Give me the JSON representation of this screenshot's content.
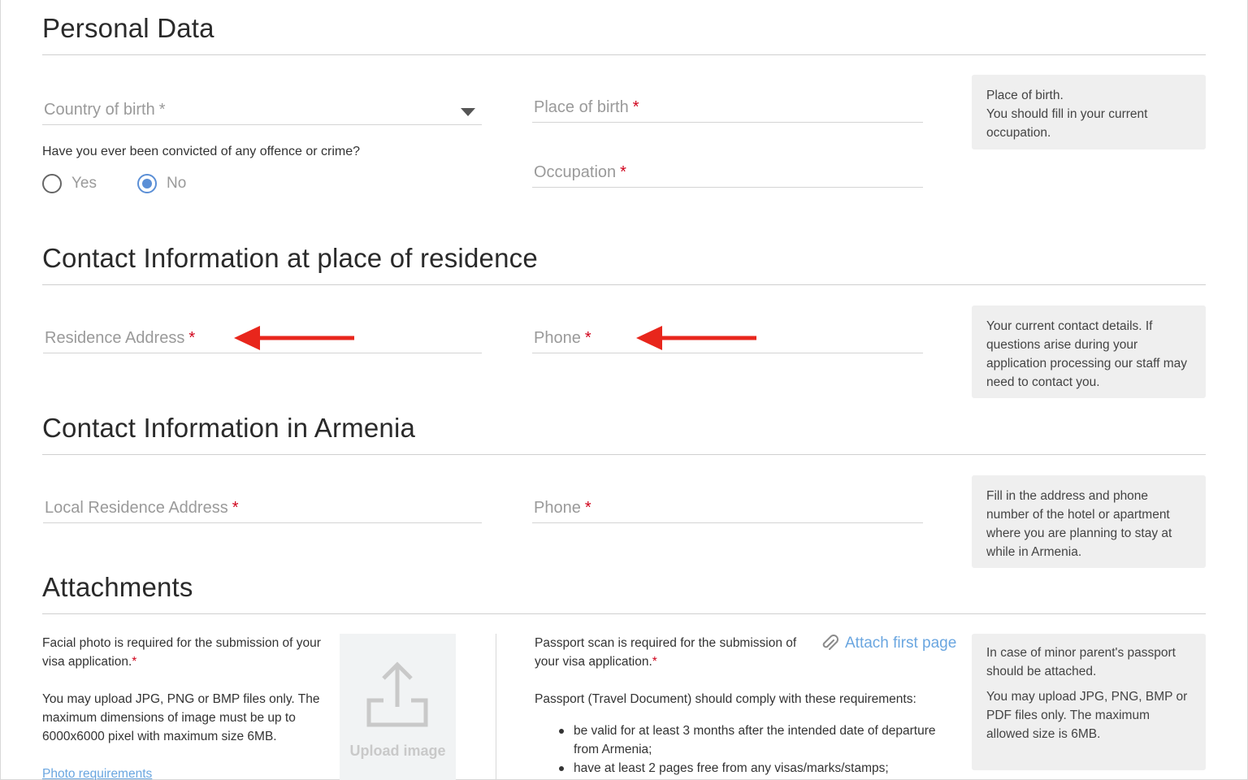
{
  "sections": {
    "personal": {
      "title": "Personal Data"
    },
    "contact_residence": {
      "title": "Contact Information at place of residence"
    },
    "contact_armenia": {
      "title": "Contact Information in Armenia"
    },
    "attachments": {
      "title": "Attachments"
    }
  },
  "personal": {
    "country_of_birth": {
      "placeholder": "Country of birth",
      "required_mark": "*",
      "value": ""
    },
    "place_of_birth": {
      "placeholder": "Place of birth",
      "required_mark": "*",
      "value": ""
    },
    "occupation": {
      "placeholder": "Occupation",
      "required_mark": "*",
      "value": ""
    },
    "conviction_question": "Have you ever been convicted of any offence or crime?",
    "radio_yes": "Yes",
    "radio_no": "No",
    "selected": "No",
    "hint_lines": [
      "Place of birth.",
      "You should fill in your current occupation."
    ]
  },
  "residence": {
    "address": {
      "placeholder": "Residence Address",
      "required_mark": "*",
      "value": ""
    },
    "phone": {
      "placeholder": "Phone",
      "required_mark": "*",
      "value": ""
    },
    "hint": "Your current contact details. If questions arise during your application processing our staff may need to contact you."
  },
  "armenia": {
    "address": {
      "placeholder": "Local Residence Address",
      "required_mark": "*",
      "value": ""
    },
    "phone": {
      "placeholder": "Phone",
      "required_mark": "*",
      "value": ""
    },
    "hint": "Fill in the address and phone number of the hotel or apartment where you are planning to stay at while in Armenia."
  },
  "attachments": {
    "photo_required": "Facial photo is required for the submission of your visa application.",
    "photo_required_mark": "*",
    "photo_formats": "You may upload JPG, PNG or BMP files only. The maximum dimensions of image must be up to 6000x6000 pixel with maximum size 6MB.",
    "photo_requirements_link": "Photo requirements",
    "upload_label": "Upload image",
    "passport_required": "Passport scan is required for the submission of your visa application.",
    "passport_required_mark": "*",
    "attach_first_page": "Attach first page",
    "passport_comply": "Passport (Travel Document) should comply with these requirements:",
    "passport_requirements": [
      "be valid for at least 3 months after the intended date of departure from Armenia;",
      "have at least 2 pages free from any visas/marks/stamps;"
    ],
    "hint_minor": "In case of minor parent's passport should be attached.",
    "hint_formats": "You may upload JPG, PNG, BMP or PDF files only. The maximum allowed size is 6MB."
  },
  "colors": {
    "accent": "#5b8fd6",
    "required": "#d0021b",
    "arrow": "#e8261c",
    "link": "#6aa6e0"
  }
}
